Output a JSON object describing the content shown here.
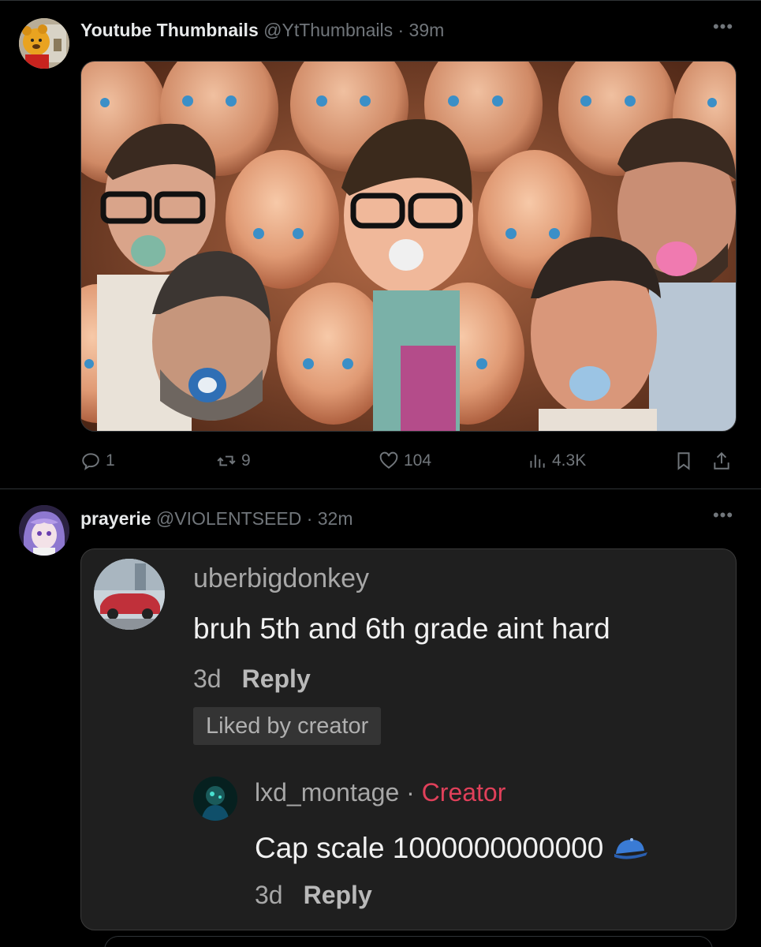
{
  "post1": {
    "display_name": "Youtube Thumbnails",
    "handle": "@YtThumbnails",
    "separator": "·",
    "time": "39m",
    "avatar_icon": "winnie-the-pooh-avatar",
    "media_description_icon": "thumbnail-image",
    "actions": {
      "reply_count": "1",
      "retweet_count": "9",
      "like_count": "104",
      "view_count": "4.3K"
    }
  },
  "post2": {
    "display_name": "prayerie",
    "handle": "@VIOLENTSEED",
    "separator": "·",
    "time": "32m",
    "avatar_icon": "anime-avatar",
    "embed": {
      "comment": {
        "username": "uberbigdonkey",
        "text": "bruh 5th and 6th grade aint hard",
        "age": "3d",
        "reply_label": "Reply",
        "badge": "Liked by creator"
      },
      "reply": {
        "username": "lxd_montage",
        "separator": "·",
        "creator_label": "Creator",
        "text": "Cap scale 1000000000000",
        "age": "3d",
        "reply_label": "Reply",
        "emoji_icon": "blue-cap-icon"
      }
    }
  },
  "colors": {
    "background": "#000000",
    "secondary_text": "#71767b",
    "creator_red": "#e0405a",
    "embed_bg": "#1f1f1f"
  }
}
